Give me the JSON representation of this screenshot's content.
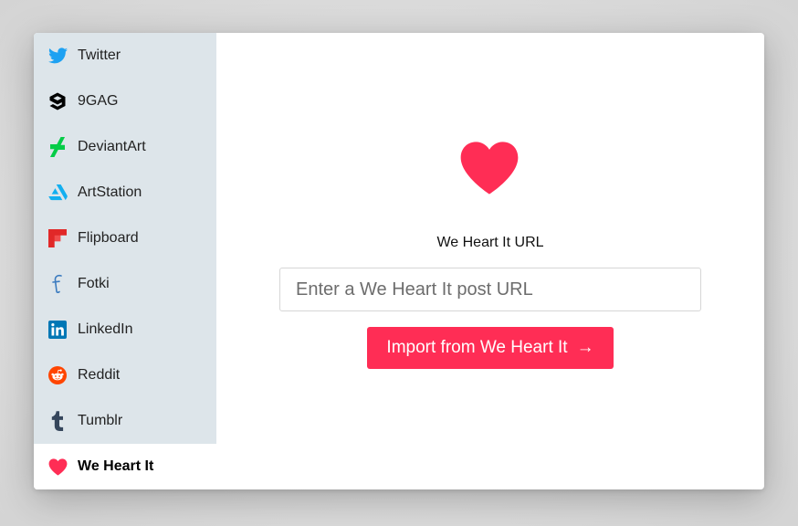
{
  "sidebar": {
    "items": [
      {
        "label": "Twitter",
        "icon": "twitter-icon",
        "color": "#1da1f2"
      },
      {
        "label": "9GAG",
        "icon": "9gag-icon",
        "color": "#000000"
      },
      {
        "label": "DeviantArt",
        "icon": "deviantart-icon",
        "color": "#05cc47"
      },
      {
        "label": "ArtStation",
        "icon": "artstation-icon",
        "color": "#13aff0"
      },
      {
        "label": "Flipboard",
        "icon": "flipboard-icon",
        "color": "#e12828"
      },
      {
        "label": "Fotki",
        "icon": "fotki-icon",
        "color": "#3b7bbf"
      },
      {
        "label": "LinkedIn",
        "icon": "linkedin-icon",
        "color": "#0077b5"
      },
      {
        "label": "Reddit",
        "icon": "reddit-icon",
        "color": "#ff4500"
      },
      {
        "label": "Tumblr",
        "icon": "tumblr-icon",
        "color": "#35465c"
      },
      {
        "label": "We Heart It",
        "icon": "heart-icon",
        "color": "#ff2d55",
        "active": true
      }
    ]
  },
  "main": {
    "hero_icon": "heart-icon",
    "field_label": "We Heart It URL",
    "input": {
      "value": "",
      "placeholder": "Enter a We Heart It post URL"
    },
    "import_button": {
      "label": "Import from We Heart It",
      "arrow": "→"
    }
  },
  "colors": {
    "accent": "#ff2d55",
    "sidebar_bg": "#dde5ea"
  }
}
